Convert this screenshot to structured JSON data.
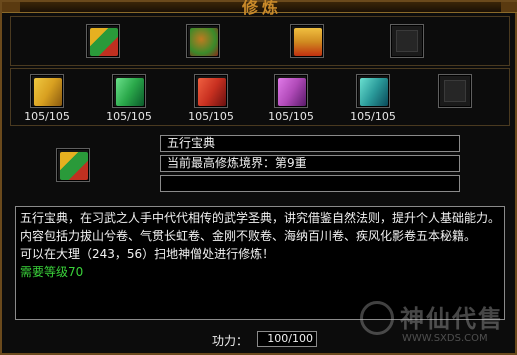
{
  "window": {
    "title": "修炼"
  },
  "top_slots": [
    {
      "icon": "multicolor-book-icon",
      "colors": [
        "#e6b020",
        "#2a9a3a",
        "#c03020"
      ]
    },
    {
      "icon": "bundle-scroll-icon",
      "colors": [
        "#3a8a2a",
        "#c07a20",
        "#8a2a1a"
      ]
    },
    {
      "icon": "golden-chest-icon",
      "colors": [
        "#d08a20",
        "#c03010",
        "#f0c040"
      ]
    },
    {
      "icon": "empty-slot-icon",
      "colors": []
    }
  ],
  "manuals": [
    {
      "icon": "gold-manual-icon",
      "color": "#d8a020",
      "count": "105/105"
    },
    {
      "icon": "green-manual-icon",
      "color": "#2aa84a",
      "count": "105/105"
    },
    {
      "icon": "red-manual-icon",
      "color": "#c83020",
      "count": "105/105"
    },
    {
      "icon": "purple-manual-icon",
      "color": "#b04ab8",
      "count": "105/105"
    },
    {
      "icon": "teal-manual-icon",
      "color": "#2a9a9a",
      "count": "105/105"
    },
    {
      "icon": "empty-slot-icon",
      "color": "",
      "count": ""
    }
  ],
  "selected": {
    "icon": "multicolor-book-icon",
    "name": "五行宝典",
    "level_text": "当前最高修炼境界：第9重",
    "third_line": ""
  },
  "description": {
    "main": "五行宝典，在习武之人手中代代相传的武学圣典，讲究借鉴自然法则，提升个人基础能力。内容包括力拔山兮卷、气贯长虹卷、金刚不败卷、海纳百川卷、疾风化影卷五本秘籍。",
    "location": "可以在大理（243，56）扫地神僧处进行修炼！",
    "requirement": "需要等级70"
  },
  "power": {
    "label": "功力：",
    "value": "100/100"
  },
  "watermark": {
    "text": "神仙代售",
    "url": "WWW.SXDS.COM"
  },
  "colors": {
    "frame": "#6b4a1c",
    "requirement_green": "#3ad23a"
  }
}
